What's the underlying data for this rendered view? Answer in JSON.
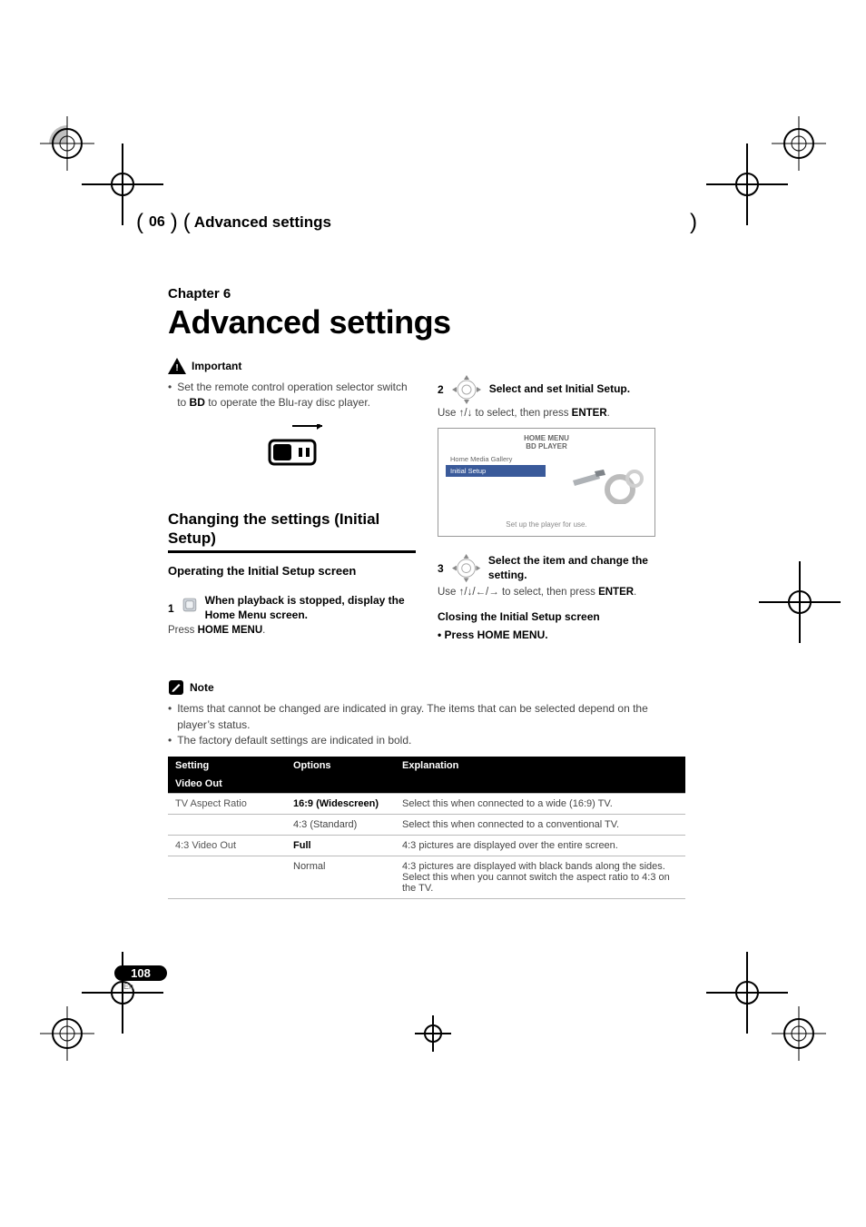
{
  "header": {
    "chapter_number": "06",
    "chapter_title": "Advanced settings"
  },
  "chapter": {
    "label": "Chapter 6",
    "title": "Advanced settings"
  },
  "important": {
    "label": "Important",
    "bullet_prefix": "•",
    "text_a": "Set the remote control operation selector switch to ",
    "text_bd": "BD",
    "text_b": " to operate the Blu-ray disc player."
  },
  "section": {
    "h2": "Changing the settings (Initial Setup)",
    "h3": "Operating the Initial Setup screen"
  },
  "steps": {
    "s1": {
      "num": "1",
      "label": "When playback is stopped, display the Home Menu screen.",
      "desc_a": "Press ",
      "desc_b": "HOME MENU",
      "desc_c": "."
    },
    "s2": {
      "num": "2",
      "label": "Select and set Initial Setup.",
      "desc_a": "Use ",
      "arrows": "↑/↓",
      "desc_b": " to select, then press ",
      "enter": "ENTER",
      "desc_c": "."
    },
    "s3": {
      "num": "3",
      "label": "Select the item and change the setting.",
      "desc_a": "Use ",
      "arrows": "↑/↓/←/→",
      "desc_b": " to select, then press ",
      "enter": "ENTER",
      "desc_c": "."
    }
  },
  "osd": {
    "title": "HOME MENU",
    "sub": "BD PLAYER",
    "items": [
      "Home Media Gallery",
      "Initial Setup"
    ],
    "selected_index": 1,
    "caption": "Set up the player for use."
  },
  "closing": {
    "h": "Closing the Initial Setup screen",
    "b": "Press HOME MENU."
  },
  "note": {
    "label": "Note",
    "lines": [
      "Items that cannot be changed are indicated in gray. The items that can be selected depend on the player’s status.",
      "The factory default settings are indicated in bold."
    ]
  },
  "table": {
    "head": {
      "c1": "Setting",
      "c2": "Options",
      "c3": "Explanation"
    },
    "section": "Video Out",
    "rows": [
      {
        "setting": "TV Aspect Ratio",
        "option": "16:9 (Widescreen)",
        "option_bold": true,
        "expl": "Select this when connected to a wide (16:9) TV."
      },
      {
        "setting": "",
        "option": "4:3 (Standard)",
        "option_bold": false,
        "expl": "Select this when connected to a conventional TV."
      },
      {
        "setting": "4:3 Video Out",
        "option": "Full",
        "option_bold": true,
        "expl": "4:3 pictures are displayed over the entire screen."
      },
      {
        "setting": "",
        "option": "Normal",
        "option_bold": false,
        "expl": "4:3 pictures are displayed with black bands along the sides. Select this when you cannot switch the aspect ratio to 4:3 on the TV."
      }
    ]
  },
  "page": {
    "num": "108",
    "lang": "En"
  }
}
